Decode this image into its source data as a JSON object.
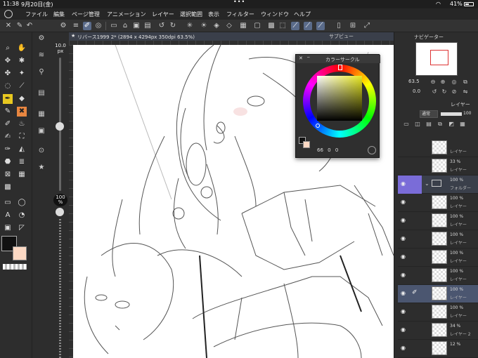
{
  "status_bar": {
    "time": "11:38",
    "date": "9月20日(金)",
    "dots": "•••",
    "battery": "41%"
  },
  "menu": {
    "items": [
      "ファイル",
      "編集",
      "ページ管理",
      "アニメーション",
      "レイヤー",
      "選択範囲",
      "表示",
      "フィルター",
      "ウィンドウ",
      "ヘルプ"
    ]
  },
  "canvas_tab": {
    "title": "リバース1999 2* (2894 x 4294px 350dpi 63.5%)"
  },
  "sub_view": {
    "label": "サブビュー"
  },
  "brush": {
    "size_label": "10.0\npx",
    "opacity_label": "100\n%"
  },
  "color_circle": {
    "title": "カラーサークル",
    "readout": {
      "h_label": "H",
      "h_value": "66",
      "s_label": "S",
      "s_value": "0",
      "v_label": "V",
      "v_value": "0"
    }
  },
  "navigator": {
    "title": "ナビゲーター",
    "zoom": "63.5",
    "angle": "0.0"
  },
  "layer_panel": {
    "title": "レイヤー",
    "blend_mode": "通常",
    "opacity": "100",
    "layers": [
      {
        "pct": "",
        "name": "レイヤー",
        "visible": false,
        "type": "normal"
      },
      {
        "pct": "33 %",
        "name": "レイヤー",
        "visible": false,
        "type": "normal"
      },
      {
        "pct": "100 %",
        "name": "フォルダー",
        "visible": true,
        "type": "folder"
      },
      {
        "pct": "100 %",
        "name": "レイヤー",
        "visible": true,
        "type": "normal"
      },
      {
        "pct": "100 %",
        "name": "レイヤー",
        "visible": true,
        "type": "normal"
      },
      {
        "pct": "100 %",
        "name": "レイヤー",
        "visible": true,
        "type": "normal"
      },
      {
        "pct": "100 %",
        "name": "レイヤー",
        "visible": true,
        "type": "normal"
      },
      {
        "pct": "100 %",
        "name": "レイヤー",
        "visible": true,
        "type": "normal"
      },
      {
        "pct": "100 %",
        "name": "レイヤー",
        "visible": true,
        "type": "selected"
      },
      {
        "pct": "100 %",
        "name": "レイヤー",
        "visible": true,
        "type": "normal"
      },
      {
        "pct": "34 %",
        "name": "レイヤー 2",
        "visible": true,
        "type": "normal"
      },
      {
        "pct": "12 %",
        "name": "",
        "visible": true,
        "type": "normal"
      }
    ]
  },
  "colors": {
    "main": "#111111",
    "sub": "#fcd9c4",
    "accent": "#7a6cd8",
    "selected_layer": "#4b5670"
  }
}
